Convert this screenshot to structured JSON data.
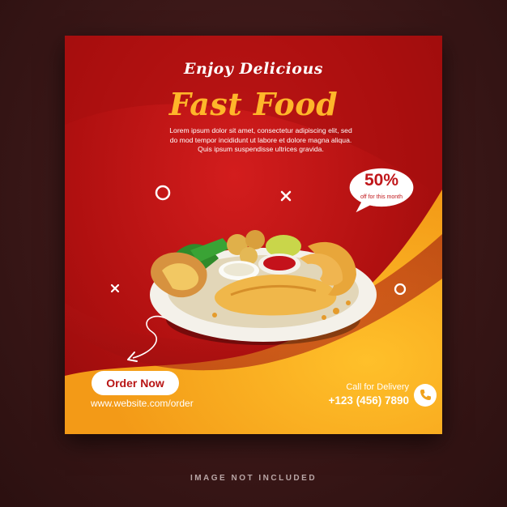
{
  "banner": {
    "tagline": "Enjoy Delicious",
    "title": "Fast Food",
    "description_lines": [
      "Lorem ipsum dolor sit amet, consectetur adipiscing elit, sed",
      "do mod tempor incididunt ut labore et dolore magna aliqua.",
      "Quis ipsum suspendisse ultrices gravida."
    ],
    "discount": {
      "value": "50%",
      "note": "off for this month"
    },
    "order_button_label": "Order Now",
    "website": "www.website.com/order",
    "call_label": "Call for Delivery",
    "phone": "+123 (456) 7890",
    "icons": [
      "phone-icon",
      "circle-outline-icon",
      "cross-icon",
      "curved-arrow-icon"
    ]
  },
  "footer_note": "IMAGE NOT INCLUDED",
  "colors": {
    "primary_red": "#c0161a",
    "accent_yellow": "#ffb62a",
    "wave_orange": "#f6a21d",
    "background": "#3a1717"
  }
}
